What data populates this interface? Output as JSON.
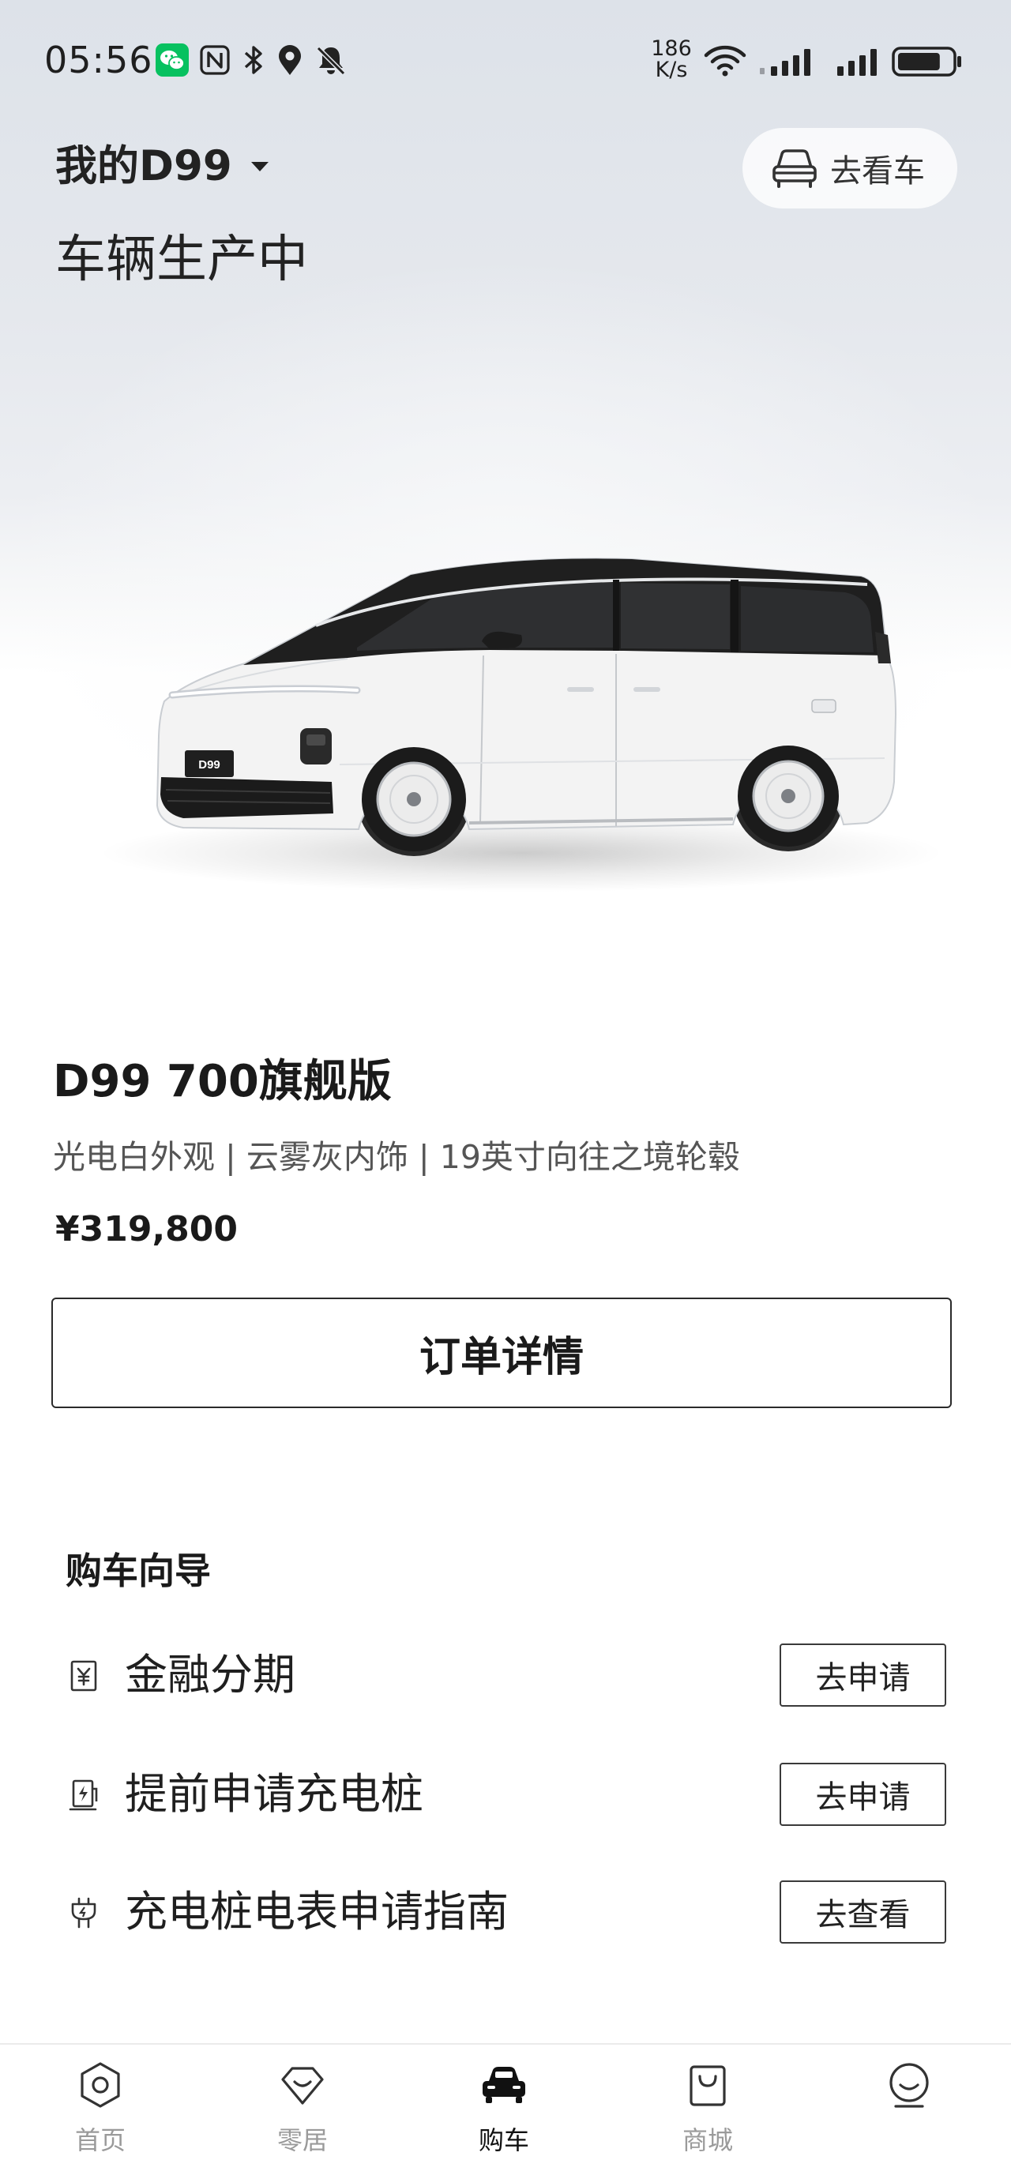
{
  "status_bar": {
    "time": "05:56",
    "net_speed": {
      "value": "186",
      "unit": "K/s"
    },
    "left_icons": [
      "wechat-icon",
      "nfc-icon",
      "bluetooth-icon",
      "location-icon",
      "mute-icon"
    ],
    "right_icons": [
      "wifi-icon",
      "signal-icon",
      "signal-icon",
      "battery-icon"
    ],
    "battery_level": 80
  },
  "header": {
    "vehicle_selector": "我的D99",
    "view_car": {
      "label": "去看车",
      "icon": "car-outline-icon"
    },
    "status": "车辆生产中"
  },
  "vehicle": {
    "model": "D99 700旗舰版",
    "config": "光电白外观 | 云雾灰内饰 | 19英寸向往之境轮毂",
    "price": "¥319,800",
    "plate_text": "D99",
    "colors": {
      "body": "#f3f3f3",
      "roof": "#1f1f1f"
    }
  },
  "order_detail_button": "订单详情",
  "purchase_guide": {
    "title": "购车向导",
    "items": [
      {
        "label": "金融分期",
        "action": "去申请",
        "icon": "finance-yuan-icon"
      },
      {
        "label": "提前申请充电桩",
        "action": "去申请",
        "icon": "charger-apply-icon"
      },
      {
        "label": "充电桩电表申请指南",
        "action": "去查看",
        "icon": "charging-pile-guide-icon"
      }
    ]
  },
  "tab_bar": {
    "items": [
      {
        "label": "首页",
        "icon": "home-hexagon-icon",
        "active": false
      },
      {
        "label": "零居",
        "icon": "community-icon",
        "active": false
      },
      {
        "label": "购车",
        "icon": "buy-car-icon",
        "active": true
      },
      {
        "label": "商城",
        "icon": "shop-bag-icon",
        "active": false
      },
      {
        "icon": "profile-icon",
        "active": false
      }
    ],
    "active_color": "#111111",
    "inactive_color": "#9a9a9a"
  },
  "theme": {
    "accent": "#111111",
    "wechat_green": "#07c160",
    "text_secondary": "#555555"
  }
}
